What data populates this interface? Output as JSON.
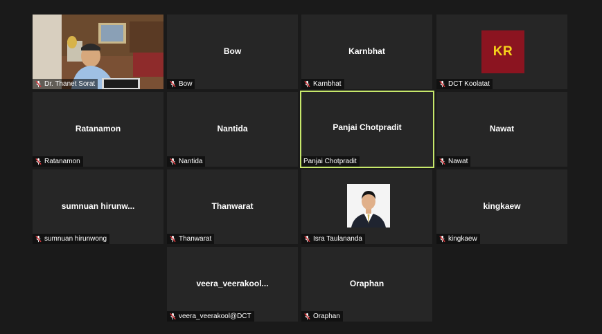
{
  "meeting": {
    "participants": [
      {
        "display_name": "",
        "label": "Dr. Thanet Sorat",
        "muted": true,
        "video": true
      },
      {
        "display_name": "Bow",
        "label": "Bow",
        "muted": true,
        "video": false
      },
      {
        "display_name": "Karnbhat",
        "label": "Karnbhat",
        "muted": true,
        "video": false
      },
      {
        "display_name": "",
        "label": "DCT Koolatat",
        "muted": true,
        "video": false,
        "avatar_text": "KR"
      },
      {
        "display_name": "Ratanamon",
        "label": "Ratanamon",
        "muted": true,
        "video": false
      },
      {
        "display_name": "Nantida",
        "label": "Nantida",
        "muted": true,
        "video": false
      },
      {
        "display_name": "Panjai Chotpradit",
        "label": "Panjai Chotpradit",
        "muted": false,
        "video": false,
        "active_speaker": true
      },
      {
        "display_name": "Nawat",
        "label": "Nawat",
        "muted": true,
        "video": false
      },
      {
        "display_name": "sumnuan  hirunw...",
        "label": "sumnuan hirunwong",
        "muted": true,
        "video": false
      },
      {
        "display_name": "Thanwarat",
        "label": "Thanwarat",
        "muted": true,
        "video": false
      },
      {
        "display_name": "",
        "label": "Isra Taulananda",
        "muted": true,
        "video": false,
        "profile_photo": true
      },
      {
        "display_name": "kingkaew",
        "label": "kingkaew",
        "muted": true,
        "video": false
      },
      {
        "display_name": "veera_veerakool...",
        "label": "veera_veerakool@DCT",
        "muted": true,
        "video": false
      },
      {
        "display_name": "Oraphan",
        "label": "Oraphan",
        "muted": true,
        "video": false
      }
    ]
  },
  "colors": {
    "background": "#1a1a1a",
    "tile": "#262626",
    "active_speaker_border": "#c7e86b",
    "muted_icon": "#e0393e",
    "kr_logo_bg": "#8b1420",
    "kr_logo_text": "#f6d31b"
  },
  "icons": {
    "muted": "microphone-muted-icon"
  }
}
